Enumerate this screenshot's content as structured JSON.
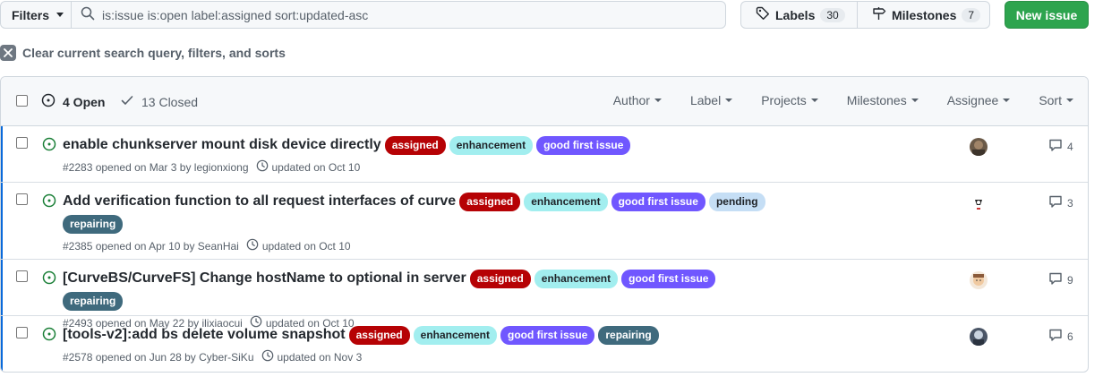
{
  "toolbar": {
    "filters_label": "Filters",
    "search_value": "is:issue is:open label:assigned sort:updated-asc",
    "labels_label": "Labels",
    "labels_count": "30",
    "milestones_label": "Milestones",
    "milestones_count": "7",
    "new_issue_label": "New issue"
  },
  "clear_filters_label": "Clear current search query, filters, and sorts",
  "header": {
    "open_label": "4 Open",
    "closed_label": "13 Closed",
    "menus": [
      "Author",
      "Label",
      "Projects",
      "Milestones",
      "Assignee",
      "Sort"
    ]
  },
  "label_colors": {
    "assigned": "#b60205",
    "enhancement": "#a2eeef",
    "good first issue": "#7057ff",
    "pending": "#c5def5",
    "repairing": "#3f6a7d"
  },
  "issues": [
    {
      "title": "enable chunkserver mount disk device directly",
      "labels": [
        "assigned",
        "enhancement",
        "good first issue"
      ],
      "meta_opened": "#2283 opened on Mar 3 by legionxiong",
      "meta_updated": "updated on Oct 10",
      "comments": "4",
      "avatar_icon": "user-avatar-legionxiong"
    },
    {
      "title": "Add verification function to all request interfaces of curve",
      "labels": [
        "assigned",
        "enhancement",
        "good first issue",
        "pending",
        "repairing"
      ],
      "meta_opened": "#2385 opened on Apr 10 by SeanHai",
      "meta_updated": "updated on Oct 10",
      "comments": "3",
      "avatar_icon": "user-avatar-seanhai"
    },
    {
      "title": "[CurveBS/CurveFS] Change hostName to optional in server",
      "labels": [
        "assigned",
        "enhancement",
        "good first issue",
        "repairing"
      ],
      "meta_opened": "#2493 opened on May 22 by ilixiaocui",
      "meta_updated": "updated on Oct 10",
      "comments": "9",
      "avatar_icon": "user-avatar-ilixiaocui"
    },
    {
      "title": "[tools-v2]:add bs delete volume snapshot",
      "labels": [
        "assigned",
        "enhancement",
        "good first issue",
        "repairing"
      ],
      "meta_opened": "#2578 opened on Jun 28 by Cyber-SiKu",
      "meta_updated": "updated on Nov 3",
      "comments": "6",
      "avatar_icon": "user-avatar-cyber-siku"
    }
  ]
}
